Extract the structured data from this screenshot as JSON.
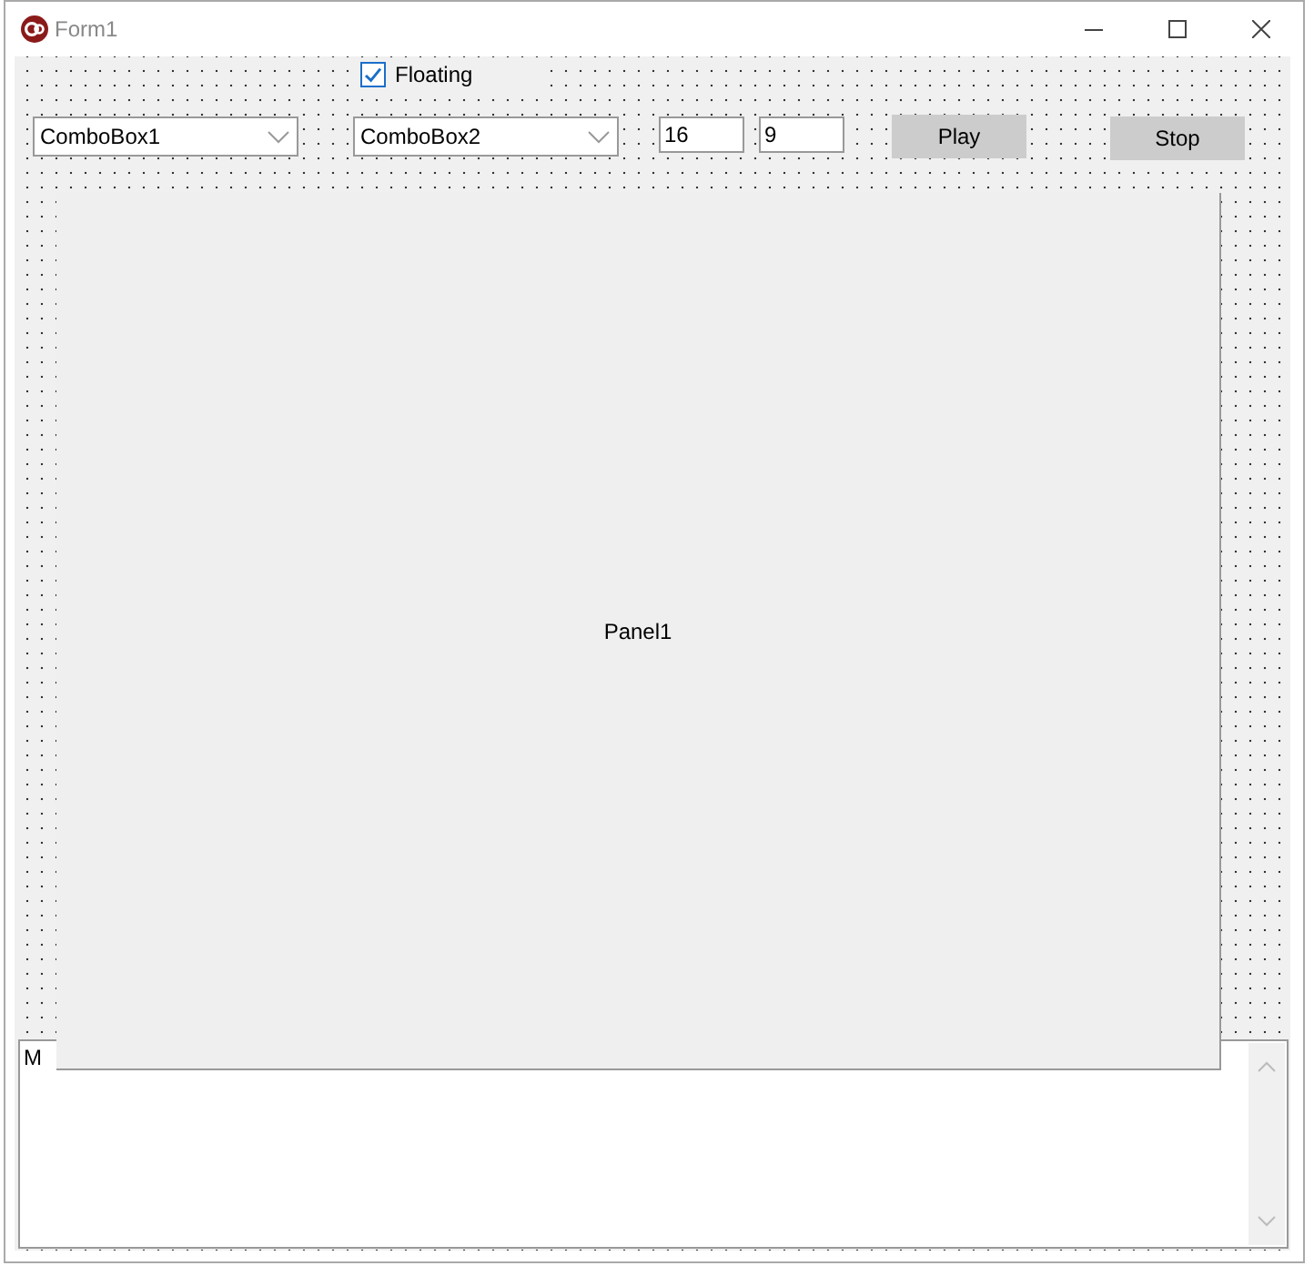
{
  "window": {
    "title": "Form1"
  },
  "checkbox": {
    "label": "Floating",
    "checked": true
  },
  "combos": [
    {
      "text": "ComboBox1"
    },
    {
      "text": "ComboBox2"
    }
  ],
  "edits": [
    {
      "value": "16"
    },
    {
      "value": "9"
    }
  ],
  "buttons": [
    {
      "label": "Play"
    },
    {
      "label": "Stop"
    }
  ],
  "panel": {
    "caption": "Panel1"
  },
  "memo": {
    "text": "M"
  }
}
